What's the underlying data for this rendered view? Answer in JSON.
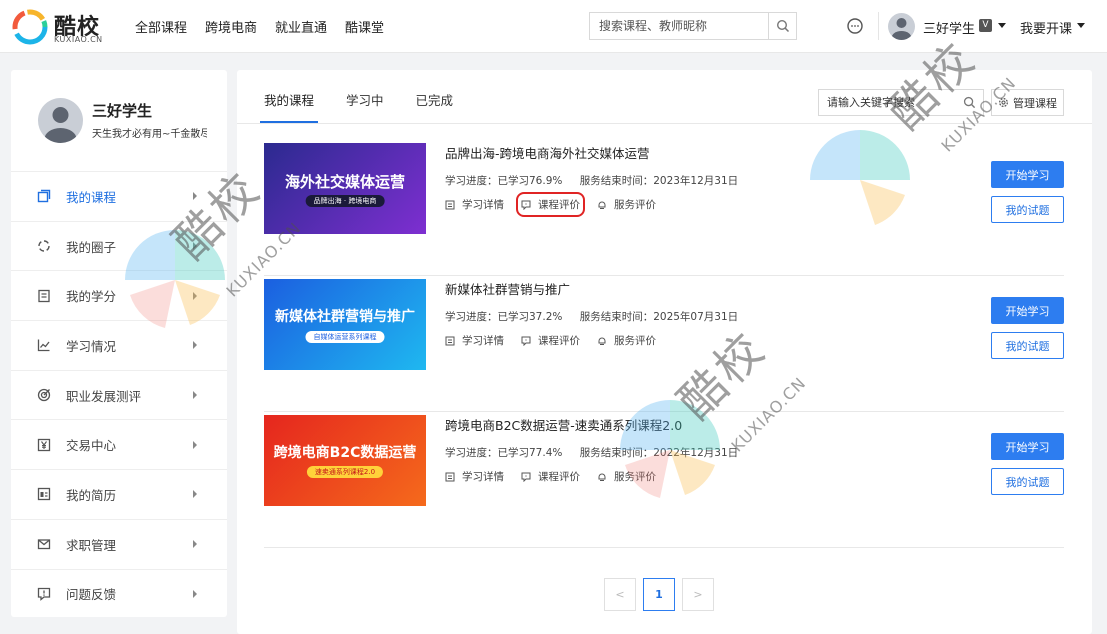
{
  "brand": {
    "name": "酷校",
    "domain": "KUXIAO.CN"
  },
  "nav": {
    "items": [
      "全部课程",
      "跨境电商",
      "就业直通",
      "酷课堂"
    ]
  },
  "search": {
    "placeholder": "搜索课程、教师昵称"
  },
  "user": {
    "name": "三好学生",
    "badge": "V"
  },
  "teach": {
    "label": "我要开课"
  },
  "profile": {
    "name": "三好学生",
    "motto": "天生我才必有用~千金散尽还复来"
  },
  "sidebar": {
    "items": [
      {
        "label": "我的课程",
        "icon": "course-icon",
        "active": true
      },
      {
        "label": "我的圈子",
        "icon": "circle-icon"
      },
      {
        "label": "我的学分",
        "icon": "credit-icon"
      },
      {
        "label": "学习情况",
        "icon": "chart-icon"
      },
      {
        "label": "职业发展测评",
        "icon": "target-icon"
      },
      {
        "label": "交易中心",
        "icon": "yen-icon"
      },
      {
        "label": "我的简历",
        "icon": "resume-icon"
      },
      {
        "label": "求职管理",
        "icon": "mail-icon"
      },
      {
        "label": "问题反馈",
        "icon": "feedback-icon"
      }
    ]
  },
  "main": {
    "tabs": [
      {
        "label": "我的课程",
        "active": true
      },
      {
        "label": "学习中"
      },
      {
        "label": "已完成"
      }
    ],
    "keyword_placeholder": "请输入关键字搜索",
    "manage_label": "管理课程",
    "link_labels": {
      "detail": "学习详情",
      "review": "课程评价",
      "service": "服务评价"
    },
    "buttons": {
      "start": "开始学习",
      "exam": "我的试题"
    },
    "courses": [
      {
        "title": "品牌出海-跨境电商海外社交媒体运营",
        "progress_label": "学习进度：已学习76.9%",
        "end_label": "服务结束时间：2023年12月31日",
        "progress": 76.9,
        "cover_title": "海外社交媒体运营",
        "cover_tag": "品牌出海 · 跨境电商",
        "cover_colors": [
          "#2b2a8f",
          "#8a2fd1"
        ],
        "review_highlighted": true
      },
      {
        "title": "新媒体社群营销与推广",
        "progress_label": "学习进度：已学习37.2%",
        "end_label": "服务结束时间：2025年07月31日",
        "progress": 37.2,
        "cover_title": "新媒体社群营销与推广",
        "cover_tag": "自媒体运营系列课程",
        "cover_colors": [
          "#1b5fe0",
          "#1fb8f0"
        ],
        "review_highlighted": false
      },
      {
        "title": "跨境电商B2C数据运营-速卖通系列课程2.0",
        "progress_label": "学习进度：已学习77.4%",
        "end_label": "服务结束时间：2022年12月31日",
        "progress": 77.4,
        "cover_title": "跨境电商B2C数据运营",
        "cover_tag": "速卖通系列课程2.0",
        "cover_colors": [
          "#e5261e",
          "#f56a1c"
        ],
        "review_highlighted": false
      }
    ]
  },
  "pagination": {
    "prev": "<",
    "current": "1",
    "next": ">"
  },
  "colors": {
    "accent": "#2d7df0",
    "highlight": "#e02424"
  }
}
